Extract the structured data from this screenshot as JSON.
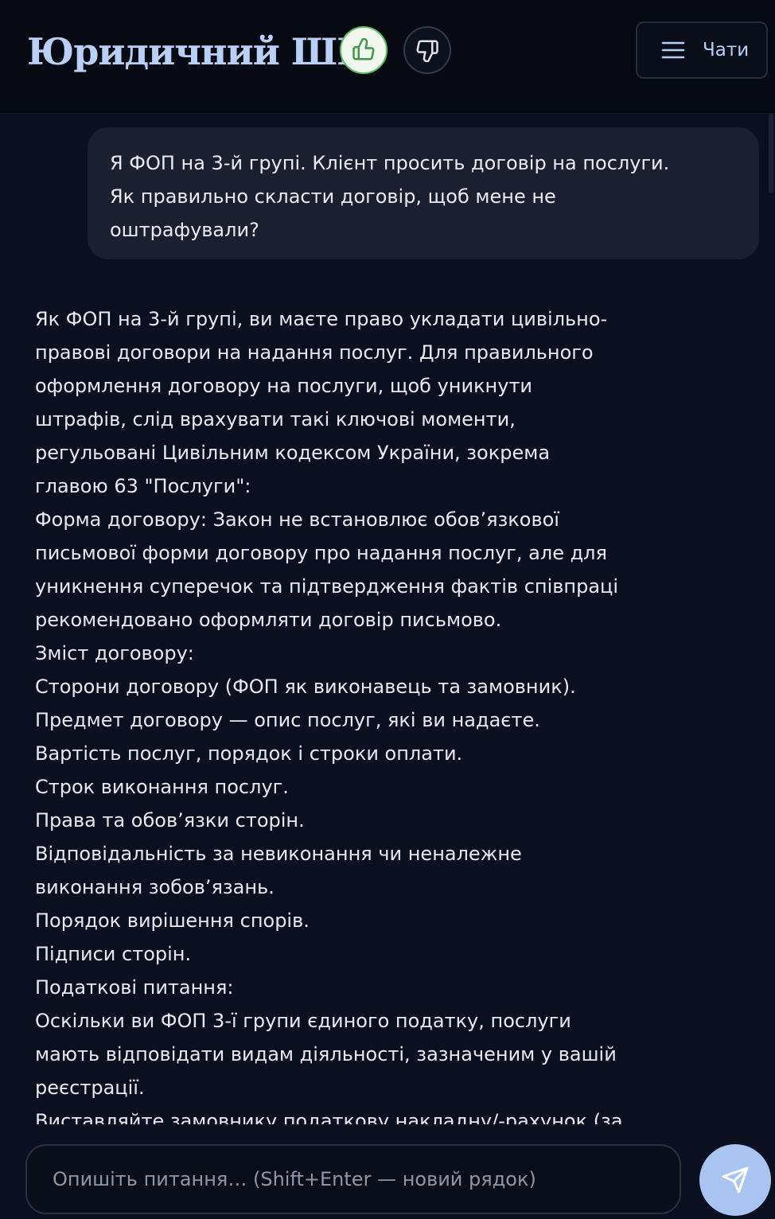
{
  "header": {
    "title": "Юридичний ШІ",
    "thumbs_up_icon": "thumbs-up-icon",
    "thumbs_down_icon": "thumbs-down-icon",
    "chats_label": "Чати",
    "menu_icon": "hamburger-menu-icon"
  },
  "colors": {
    "background": "#0b1020",
    "accent": "#b9cff5",
    "like_green": "#5bbf62",
    "send_button": "#a9c4f0",
    "user_bubble": "#1a2030"
  },
  "conversation": {
    "user_message": {
      "lines": [
        "Я ФОП на 3-й групі. Клієнт просить договір на послуги.",
        "Як правильно скласти договір, щоб мене не",
        "оштрафували?"
      ]
    },
    "assistant_message": {
      "lines": [
        "Як ФОП на 3-й групі, ви маєте право укладати цивільно-",
        "правові договори на надання послуг. Для правильного",
        "оформлення договору на послуги, щоб уникнути",
        "штрафів, слід врахувати такі ключові моменти,",
        "регульовані Цивільним кодексом України, зокрема",
        "главою 63 \"Послуги\":",
        "Форма договору: Закон не встановлює обов’язкової",
        "письмової форми договору про надання послуг, але для",
        "уникнення суперечок та підтвердження фактів співпраці",
        "рекомендовано оформляти договір письмово.",
        "Зміст договору:",
        "Сторони договору (ФОП як виконавець та замовник).",
        "Предмет договору — опис послуг, які ви надаєте.",
        "Вартість послуг, порядок і строки оплати.",
        "Строк виконання послуг.",
        "Права та обов’язки сторін.",
        "Відповідальність за невиконання чи неналежне",
        "виконання зобов’язань.",
        "Порядок вирішення спорів.",
        "Підписи сторін.",
        "Податкові питання:",
        "Оскільки ви ФОП 3-ї групи єдиного податку, послуги",
        "мають відповідати видам діяльності, зазначеним у вашій",
        "реєстрації.",
        "Виставляйте замовнику податкову накладну/-рахунок (за"
      ]
    }
  },
  "composer": {
    "placeholder": "Опишіть питання… (Shift+Enter — новий рядок)",
    "value": "",
    "send_icon": "send-paper-plane-icon"
  }
}
